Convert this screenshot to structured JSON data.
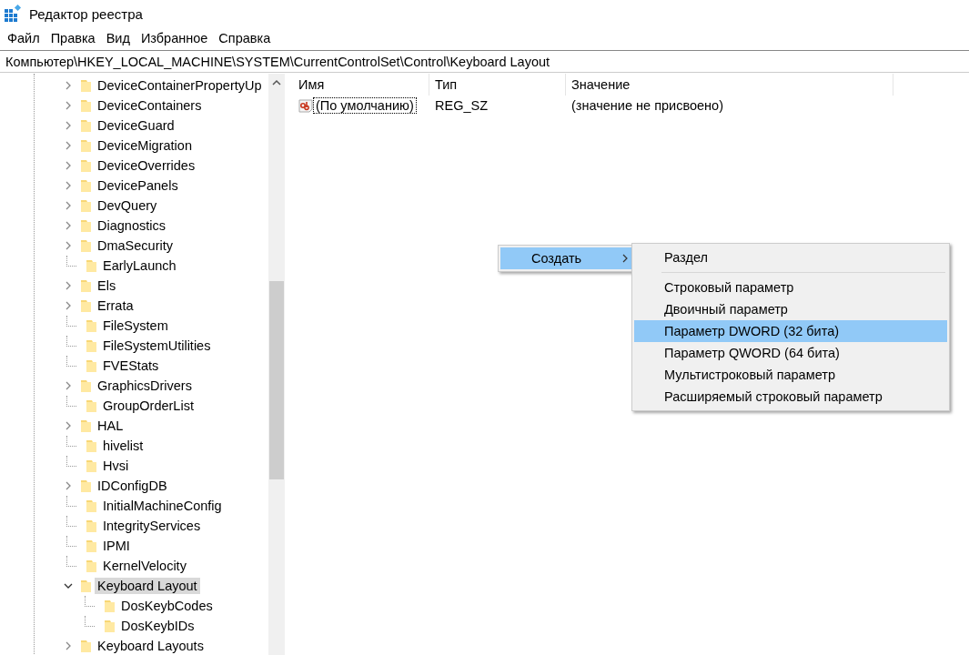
{
  "window": {
    "title": "Редактор реестра"
  },
  "menu_bar": [
    "Файл",
    "Правка",
    "Вид",
    "Избранное",
    "Справка"
  ],
  "address_bar": {
    "value": "Компьютер\\HKEY_LOCAL_MACHINE\\SYSTEM\\CurrentControlSet\\Control\\Keyboard Layout"
  },
  "tree": [
    {
      "label": "DeviceContainerPropertyUp",
      "kind": "node",
      "expanded": false,
      "selected": false
    },
    {
      "label": "DeviceContainers",
      "kind": "node",
      "expanded": false,
      "selected": false
    },
    {
      "label": "DeviceGuard",
      "kind": "node",
      "expanded": false,
      "selected": false
    },
    {
      "label": "DeviceMigration",
      "kind": "node",
      "expanded": false,
      "selected": false
    },
    {
      "label": "DeviceOverrides",
      "kind": "node",
      "expanded": false,
      "selected": false
    },
    {
      "label": "DevicePanels",
      "kind": "node",
      "expanded": false,
      "selected": false
    },
    {
      "label": "DevQuery",
      "kind": "node",
      "expanded": false,
      "selected": false
    },
    {
      "label": "Diagnostics",
      "kind": "node",
      "expanded": false,
      "selected": false
    },
    {
      "label": "DmaSecurity",
      "kind": "node",
      "expanded": false,
      "selected": false
    },
    {
      "label": "EarlyLaunch",
      "kind": "leaf",
      "selected": false
    },
    {
      "label": "Els",
      "kind": "node",
      "expanded": false,
      "selected": false
    },
    {
      "label": "Errata",
      "kind": "node",
      "expanded": false,
      "selected": false
    },
    {
      "label": "FileSystem",
      "kind": "leaf",
      "selected": false
    },
    {
      "label": "FileSystemUtilities",
      "kind": "leaf",
      "selected": false
    },
    {
      "label": "FVEStats",
      "kind": "leaf",
      "selected": false
    },
    {
      "label": "GraphicsDrivers",
      "kind": "node",
      "expanded": false,
      "selected": false
    },
    {
      "label": "GroupOrderList",
      "kind": "leaf",
      "selected": false
    },
    {
      "label": "HAL",
      "kind": "node",
      "expanded": false,
      "selected": false
    },
    {
      "label": "hivelist",
      "kind": "leaf",
      "selected": false
    },
    {
      "label": "Hvsi",
      "kind": "leaf",
      "selected": false
    },
    {
      "label": "IDConfigDB",
      "kind": "node",
      "expanded": false,
      "selected": false
    },
    {
      "label": "InitialMachineConfig",
      "kind": "leaf",
      "selected": false
    },
    {
      "label": "IntegrityServices",
      "kind": "leaf",
      "selected": false
    },
    {
      "label": "IPMI",
      "kind": "leaf",
      "selected": false
    },
    {
      "label": "KernelVelocity",
      "kind": "leaf",
      "selected": false
    },
    {
      "label": "Keyboard Layout",
      "kind": "node",
      "expanded": true,
      "selected": true,
      "children": [
        {
          "label": "DosKeybCodes",
          "kind": "leaf",
          "selected": false
        },
        {
          "label": "DosKeybIDs",
          "kind": "leaf",
          "selected": false
        }
      ]
    },
    {
      "label": "Keyboard Layouts",
      "kind": "node",
      "expanded": false,
      "selected": false
    }
  ],
  "values_table": {
    "columns": [
      "Имя",
      "Тип",
      "Значение"
    ],
    "rows": [
      {
        "name": "(По умолчанию)",
        "type": "REG_SZ",
        "value": "(значение не присвоено)",
        "focused": true
      }
    ]
  },
  "context_menu": {
    "items": [
      {
        "label": "Создать",
        "selected": true,
        "has_submenu": true
      }
    ]
  },
  "submenu": {
    "items": [
      {
        "kind": "item",
        "label": "Раздел",
        "selected": false
      },
      {
        "kind": "separator"
      },
      {
        "kind": "item",
        "label": "Строковый параметр",
        "selected": false
      },
      {
        "kind": "item",
        "label": "Двоичный параметр",
        "selected": false
      },
      {
        "kind": "item",
        "label": "Параметр DWORD (32 бита)",
        "selected": true
      },
      {
        "kind": "item",
        "label": "Параметр QWORD (64 бита)",
        "selected": false
      },
      {
        "kind": "item",
        "label": "Мультистроковый параметр",
        "selected": false
      },
      {
        "kind": "item",
        "label": "Расширяемый строковый параметр",
        "selected": false
      }
    ]
  }
}
